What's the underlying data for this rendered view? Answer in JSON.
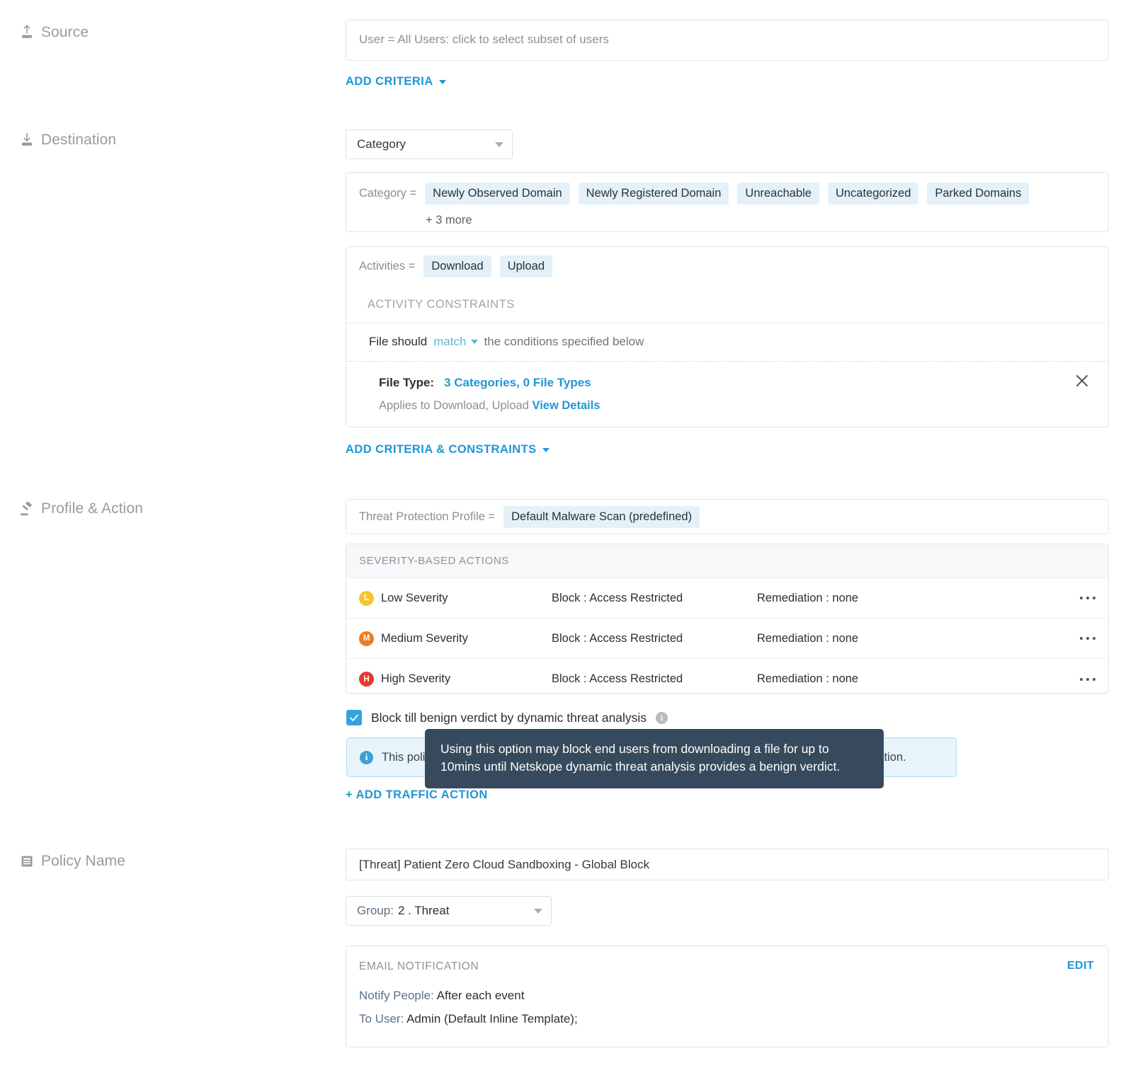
{
  "sections": {
    "source": {
      "label": "Source",
      "icon": "upload-icon"
    },
    "destination": {
      "label": "Destination",
      "icon": "download-icon"
    },
    "profile_action": {
      "label": "Profile & Action",
      "icon": "gavel-icon"
    },
    "policy_name": {
      "label": "Policy Name",
      "icon": "document-icon"
    }
  },
  "source": {
    "user_field_text": "User = All Users: click to select subset of users",
    "add_criteria_label": "ADD CRITERIA"
  },
  "destination": {
    "type_select_value": "Category",
    "category": {
      "eq_label": "Category =",
      "chips": [
        "Newly Observed Domain",
        "Newly Registered Domain",
        "Unreachable",
        "Uncategorized",
        "Parked Domains"
      ],
      "more_label": "+ 3 more"
    },
    "activities": {
      "eq_label": "Activities =",
      "chips": [
        "Download",
        "Upload"
      ]
    },
    "constraints": {
      "header": "ACTIVITY CONSTRAINTS",
      "file_should_prefix": "File should",
      "file_should_mode": "match",
      "file_should_suffix": "the conditions specified below",
      "file_type_key": "File Type:",
      "file_type_value": "3 Categories, 0 File Types",
      "applies_to_text": "Applies to Download, Upload",
      "view_details_label": "View Details"
    },
    "add_criteria_constraints_label": "ADD CRITERIA & CONSTRAINTS"
  },
  "profile_action": {
    "threat_profile_label": "Threat Protection Profile =",
    "threat_profile_value": "Default Malware Scan (predefined)",
    "severity_table": {
      "header": "SEVERITY-BASED ACTIONS",
      "rows": [
        {
          "badge": "L",
          "badge_color": "#f5c430",
          "name": "Low Severity",
          "action": "Block : Access Restricted",
          "remediation": "Remediation : none"
        },
        {
          "badge": "M",
          "badge_color": "#ef7c20",
          "name": "Medium Severity",
          "action": "Block : Access Restricted",
          "remediation": "Remediation : none"
        },
        {
          "badge": "H",
          "badge_color": "#e8372e",
          "name": "High Severity",
          "action": "Block : Access Restricted",
          "remediation": "Remediation : none"
        }
      ]
    },
    "checkbox_label": "Block till benign verdict by dynamic threat analysis",
    "checkbox_checked": true,
    "banner_text": "This policy should be on top of the threat protection policies for that source + destination combination.",
    "tooltip_text": "Using this option may block end users from downloading a file for up to 10mins until Netskope dynamic threat analysis provides a benign verdict.",
    "add_traffic_action_label": "+ ADD TRAFFIC ACTION"
  },
  "policy_name": {
    "name_value": "[Threat] Patient Zero Cloud Sandboxing - Global Block",
    "group_key": "Group:",
    "group_value": "2 . Threat",
    "email": {
      "header": "EMAIL NOTIFICATION",
      "edit_label": "EDIT",
      "notify_key": "Notify People:",
      "notify_value": "After each event",
      "touser_key": "To User:",
      "touser_value": "Admin (Default Inline Template);"
    }
  },
  "colors": {
    "accent": "#2196d6",
    "chip_bg": "#e4f1f9",
    "tooltip_bg": "#37495c",
    "banner_bg": "#e8f4fb",
    "checkbox": "#32a3dd"
  }
}
